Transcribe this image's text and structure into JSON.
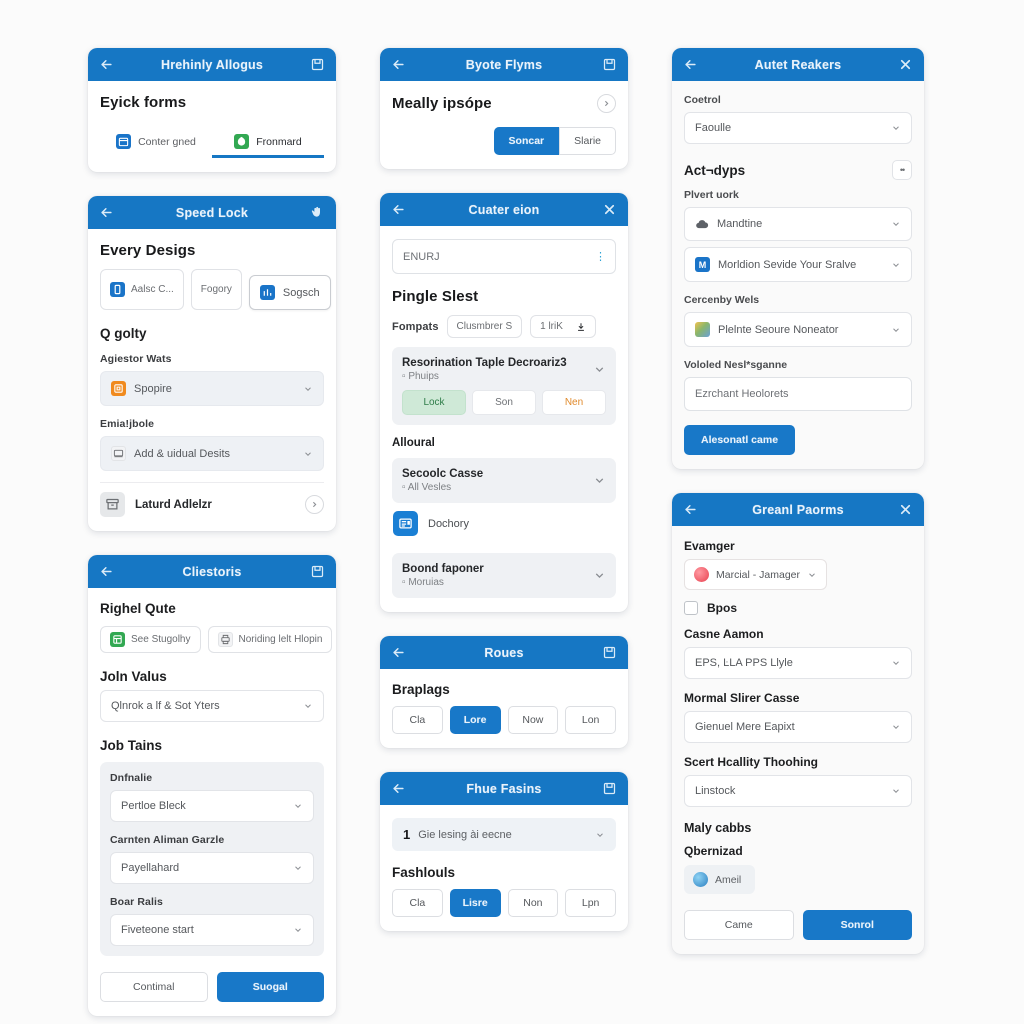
{
  "background": "#fbfbfb",
  "accent": "#1677c4",
  "cards": {
    "quick_forms": {
      "header": {
        "title": "Hrehinly Allogus",
        "back_icon": "back-arrow-icon",
        "action_icon": "save-icon"
      },
      "title": "Eyick forms",
      "tabs": [
        {
          "label": "Conter gned",
          "icon": "calendar-icon",
          "active": false
        },
        {
          "label": "Fronmard",
          "icon": "leaf-icon",
          "active": true
        }
      ]
    },
    "speed_lock": {
      "header": {
        "title": "Speed Lock",
        "back_icon": "back-arrow-icon",
        "action_icon": "hand-icon"
      },
      "title": "Every Desigs",
      "chips": [
        {
          "label": "Aalsc C...",
          "icon": "phone-icon"
        },
        {
          "label": "Fogory",
          "icon": ""
        },
        {
          "label": "Sogsch",
          "icon": "chart-icon",
          "selected": true
        }
      ],
      "section": "Q golty",
      "field1_label": "Agiestor Wats",
      "field1_value": "Spopire",
      "field1_icon": "orange-app-icon",
      "field2_label": "Emia!jbole",
      "field2_value": "Add & uidual Desits",
      "field2_icon": "device-icon",
      "list_item": "Laturd Adlelzr",
      "list_item_icon": "archive-icon"
    },
    "checklists": {
      "header": {
        "title": "Cliestoris",
        "back_icon": "back-arrow-icon",
        "action_icon": "save-icon"
      },
      "title": "Righel Qute",
      "chips": [
        {
          "label": "See Stugolhy",
          "icon": "green-sheet-icon"
        },
        {
          "label": "Noriding lelt Hlopin",
          "icon": "printer-icon"
        }
      ],
      "field1_label": "Joln Valus",
      "field1_value": "Qlnrok a lf & Sot Yters",
      "section": "Job Tains",
      "panel": {
        "label1": "Dnfnalie",
        "value1": "Pertloe Bleck",
        "label2": "Carnten Aliman Garzle",
        "value2": "Payellahard",
        "label3": "Boar Ralis",
        "value3": "Fiveteone start"
      },
      "cancel": "Contimal",
      "submit": "Suogal"
    },
    "byte_flyms": {
      "header": {
        "title": "Byote Flyms",
        "back_icon": "back-arrow-icon",
        "action_icon": "save-icon"
      },
      "title": "Meally ipsópe",
      "chevron_icon": "chevron-right-icon",
      "primary": "Soncar",
      "secondary": "Slarie"
    },
    "cuater": {
      "header": {
        "title": "Cuater eion",
        "back_icon": "back-arrow-icon",
        "action_icon": "close-icon"
      },
      "input_value": "ENURJ",
      "input_trailing_icon": "cursor-icon",
      "section": "Pingle Slest",
      "filter_label": "Fompats",
      "filter_chips": [
        {
          "label": "Clusmbrer S"
        },
        {
          "label": "1 lriK",
          "icon": "download-icon"
        }
      ],
      "group1": {
        "title": "Resorination Taple Decroariz3",
        "sub": "Phuips",
        "seg": [
          "Lock",
          "Son",
          "Nen"
        ]
      },
      "group_label": "Alloural",
      "group2": {
        "title": "Secoolc Casse",
        "sub": "All Vesles"
      },
      "row": {
        "label": "Dochory",
        "icon": "news-icon"
      },
      "group3": {
        "title": "Boond faponer",
        "sub": "Moruias"
      }
    },
    "roues": {
      "header": {
        "title": "Roues",
        "back_icon": "back-arrow-icon",
        "action_icon": "save-icon"
      },
      "title": "Braplags",
      "options": [
        "Cla",
        "Lore",
        "Now",
        "Lon"
      ],
      "selected": 1
    },
    "flue_fasins": {
      "header": {
        "title": "Fhue Fasins",
        "back_icon": "back-arrow-icon",
        "action_icon": "save-icon"
      },
      "num": "1",
      "num_text": "Gie lesing ài eecne",
      "title": "Fashlouls",
      "options": [
        "Cla",
        "Lisre",
        "Non",
        "Lpn"
      ],
      "selected": 1
    },
    "autet_reakers": {
      "header": {
        "title": "Autet Reakers",
        "back_icon": "back-arrow-icon",
        "action_icon": "close-icon"
      },
      "label1": "Coetrol",
      "value1": "Faoulle",
      "section": "Act¬dyps",
      "more_icon": "more-icon",
      "label2": "Plvert uork",
      "value2": "Mandtine",
      "value2_icon": "cloud-icon",
      "value3": "Morldion Sevide Your Sralve",
      "value3_icon": "blue-m-icon",
      "label3": "Cercenby Wels",
      "value4": "Plelnte Seoure Noneator",
      "value4_icon": "photo-icon",
      "label4": "Vololed Nesl*sganne",
      "input_value": "Ezrchant Heolorets",
      "submit": "Alesonatl came"
    },
    "greanl_paorms": {
      "header": {
        "title": "Greanl Paorms",
        "back_icon": "back-arrow-icon",
        "action_icon": "close-icon"
      },
      "label1": "Evamger",
      "value1": "Marcial - Jamager",
      "value1_icon": "red-avatar-icon",
      "checkbox_label": "Bpos",
      "label2": "Casne Aamon",
      "value2": "EPS, ĿLA PPS Llyle",
      "label3": "Mormal Slirer Casse",
      "value3": "Gienuel Mere Eapixt",
      "label4": "Scert Hcallity Thoohing",
      "value4": "Linstock",
      "section1": "Maly cabbs",
      "section2": "Qbernizad",
      "tag": "Ameil",
      "tag_icon": "blue-avatar-icon",
      "cancel": "Came",
      "submit": "Sonrol"
    }
  }
}
